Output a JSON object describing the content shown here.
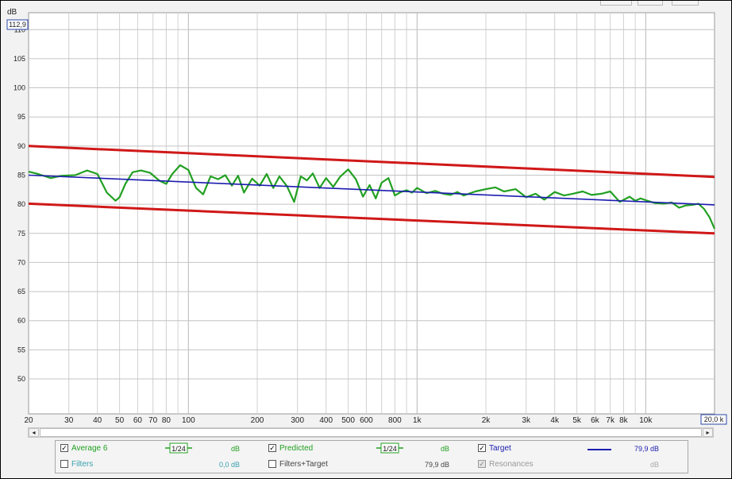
{
  "colors": {
    "average": "#22a022",
    "predicted": "#22a022",
    "target": "#1c1cb0",
    "limits": "#d01818",
    "filters_text": "#3aa0b0",
    "grid": "#c8c8c8"
  },
  "chart_data": {
    "type": "line",
    "x_scale": "log",
    "y_unit_label": "dB",
    "ylim": [
      44,
      112.9
    ],
    "y_max_readout": "112,9",
    "xlim": [
      20,
      20000
    ],
    "x_max_readout": "20,0 k",
    "y_ticks": [
      50,
      55,
      60,
      65,
      70,
      75,
      80,
      85,
      90,
      95,
      100,
      105,
      110
    ],
    "x_tick_labels": [
      {
        "v": 20,
        "t": "20"
      },
      {
        "v": 30,
        "t": "30"
      },
      {
        "v": 40,
        "t": "40"
      },
      {
        "v": 50,
        "t": "50"
      },
      {
        "v": 60,
        "t": "60"
      },
      {
        "v": 70,
        "t": "70"
      },
      {
        "v": 80,
        "t": "80"
      },
      {
        "v": 100,
        "t": "100"
      },
      {
        "v": 200,
        "t": "200"
      },
      {
        "v": 300,
        "t": "300"
      },
      {
        "v": 400,
        "t": "400"
      },
      {
        "v": 500,
        "t": "500"
      },
      {
        "v": 600,
        "t": "600"
      },
      {
        "v": 800,
        "t": "800"
      },
      {
        "v": 1000,
        "t": "1k"
      },
      {
        "v": 2000,
        "t": "2k"
      },
      {
        "v": 3000,
        "t": "3k"
      },
      {
        "v": 4000,
        "t": "4k"
      },
      {
        "v": 5000,
        "t": "5k"
      },
      {
        "v": 6000,
        "t": "6k"
      },
      {
        "v": 7000,
        "t": "7k"
      },
      {
        "v": 8000,
        "t": "8k"
      },
      {
        "v": 10000,
        "t": "10k"
      }
    ],
    "grid": true,
    "series": [
      {
        "name": "Average 6",
        "kind": "measurement",
        "x": [
          20,
          22,
          25,
          28,
          32,
          36,
          40,
          44,
          48,
          50,
          53,
          57,
          62,
          68,
          75,
          80,
          85,
          92,
          100,
          108,
          116,
          125,
          135,
          145,
          155,
          165,
          175,
          190,
          205,
          220,
          235,
          250,
          270,
          290,
          310,
          330,
          350,
          375,
          400,
          430,
          460,
          500,
          540,
          580,
          620,
          660,
          700,
          750,
          800,
          850,
          900,
          950,
          1000,
          1100,
          1200,
          1300,
          1400,
          1500,
          1600,
          1800,
          2000,
          2200,
          2400,
          2700,
          3000,
          3300,
          3600,
          4000,
          4400,
          4800,
          5300,
          5800,
          6400,
          7000,
          7700,
          8500,
          9000,
          9500,
          10000,
          11000,
          12000,
          13000,
          14000,
          15000,
          16000,
          17000,
          18000,
          19000,
          20000
        ],
        "y": [
          85.6,
          85.2,
          84.5,
          84.9,
          85.0,
          85.8,
          85.2,
          82.0,
          80.6,
          81.2,
          83.5,
          85.5,
          85.8,
          85.4,
          84.0,
          83.5,
          85.2,
          86.7,
          85.9,
          82.8,
          81.7,
          84.8,
          84.3,
          85.0,
          83.2,
          84.9,
          82.0,
          84.4,
          83.2,
          85.2,
          82.8,
          84.8,
          83.1,
          80.4,
          84.8,
          84.1,
          85.3,
          82.8,
          84.5,
          83.0,
          84.7,
          86.0,
          84.3,
          81.3,
          83.3,
          81.0,
          83.7,
          84.5,
          81.5,
          82.1,
          82.4,
          82.0,
          82.8,
          81.9,
          82.3,
          81.8,
          81.6,
          82.1,
          81.5,
          82.2,
          82.6,
          82.9,
          82.2,
          82.6,
          81.2,
          81.8,
          80.8,
          82.1,
          81.5,
          81.8,
          82.2,
          81.6,
          81.8,
          82.2,
          80.4,
          81.3,
          80.6,
          81.0,
          80.7,
          80.2,
          80.1,
          80.3,
          79.4,
          79.8,
          79.9,
          80.1,
          79.2,
          77.8,
          75.8
        ]
      },
      {
        "name": "Target",
        "kind": "target",
        "value_readout": "79,9 dB",
        "x": [
          20,
          20000
        ],
        "y": [
          85.0,
          79.9
        ]
      },
      {
        "name": "upper limit",
        "kind": "limit",
        "x": [
          20,
          20000
        ],
        "y": [
          90.0,
          84.7
        ]
      },
      {
        "name": "lower limit",
        "kind": "limit",
        "x": [
          20,
          20000
        ],
        "y": [
          80.1,
          75.0
        ]
      }
    ]
  },
  "legend": {
    "average": {
      "label": "Average 6",
      "smoothing": "1/24",
      "unit": "dB",
      "checked": true
    },
    "predicted": {
      "label": "Predicted",
      "smoothing": "1/24",
      "unit": "dB",
      "checked": true
    },
    "target": {
      "label": "Target",
      "value": "79,9 dB",
      "checked": true
    },
    "filters": {
      "label": "Filters",
      "value": "0,0 dB",
      "checked": false
    },
    "filters_target": {
      "label": "Filters+Target",
      "value": "79,9 dB",
      "checked": false
    },
    "resonances": {
      "label": "Resonances",
      "unit": "dB",
      "checked": true
    }
  },
  "scrollbar": {
    "left_arrow": "◂",
    "right_arrow": "▸"
  }
}
